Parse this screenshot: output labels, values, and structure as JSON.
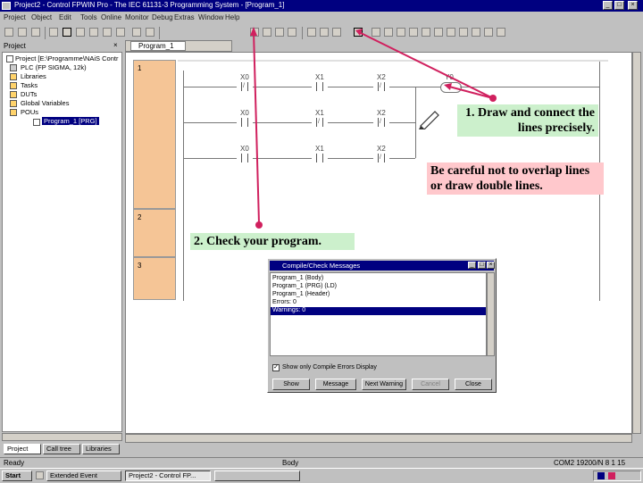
{
  "window": {
    "title": "Project2 - Control FPWIN Pro - The IEC 61131-3 Programming System - [Program_1]"
  },
  "menu": [
    "Project",
    "Object",
    "Edit",
    "Tools",
    "Online",
    "Monitor",
    "Debug",
    "Extras",
    "Window",
    "Help"
  ],
  "toolbar": {
    "combo_value": "",
    "doc_tab": "Program_1"
  },
  "project_tree": {
    "header": "Project",
    "items": [
      "Project [E:\\Programme\\NAiS Contr",
      "PLC (FP SIGMA, 12k)",
      "Libraries",
      "Tasks",
      "DUTs",
      "Global Variables",
      "POUs",
      "Program_1 [PRG]"
    ],
    "tabs": [
      "Project",
      "Call tree",
      "Libraries"
    ]
  },
  "ladder": {
    "rungs": [
      "1",
      "2",
      "3"
    ],
    "row1": [
      "X0",
      "X1",
      "X2",
      "Y0"
    ],
    "row2": [
      "X0",
      "X1",
      "X2"
    ],
    "row3": [
      "X0",
      "X1",
      "X2"
    ]
  },
  "annotations": {
    "step1": "1. Draw and connect the lines precisely.",
    "careful": "Be careful not to overlap lines or draw double lines.",
    "step2": "2. Check your program."
  },
  "dialog": {
    "title": "Compile/Check Messages",
    "messages": [
      "Program_1 (Body)",
      "Program_1 (PRG) (LD)",
      "Program_1 (Header)",
      "Errors: 0",
      "Warnings: 0"
    ],
    "checkbox_label": "Show only Compile Errors Display",
    "buttons": [
      "Show",
      "Message",
      "Next Warning",
      "Cancel",
      "Close"
    ]
  },
  "statusbar": {
    "left": "Ready",
    "mid": "Body",
    "right": "COM2 19200/N 8 1 15"
  },
  "taskbar": {
    "start": "Start",
    "tasks": [
      "Extended Event",
      "Project2 - Control FP...",
      ""
    ]
  },
  "colors": {
    "accent_arrow": "#d0205e",
    "rung_fill": "#f5c596",
    "callout_green": "#ccf0cc",
    "callout_pink": "#ffc8cc"
  }
}
